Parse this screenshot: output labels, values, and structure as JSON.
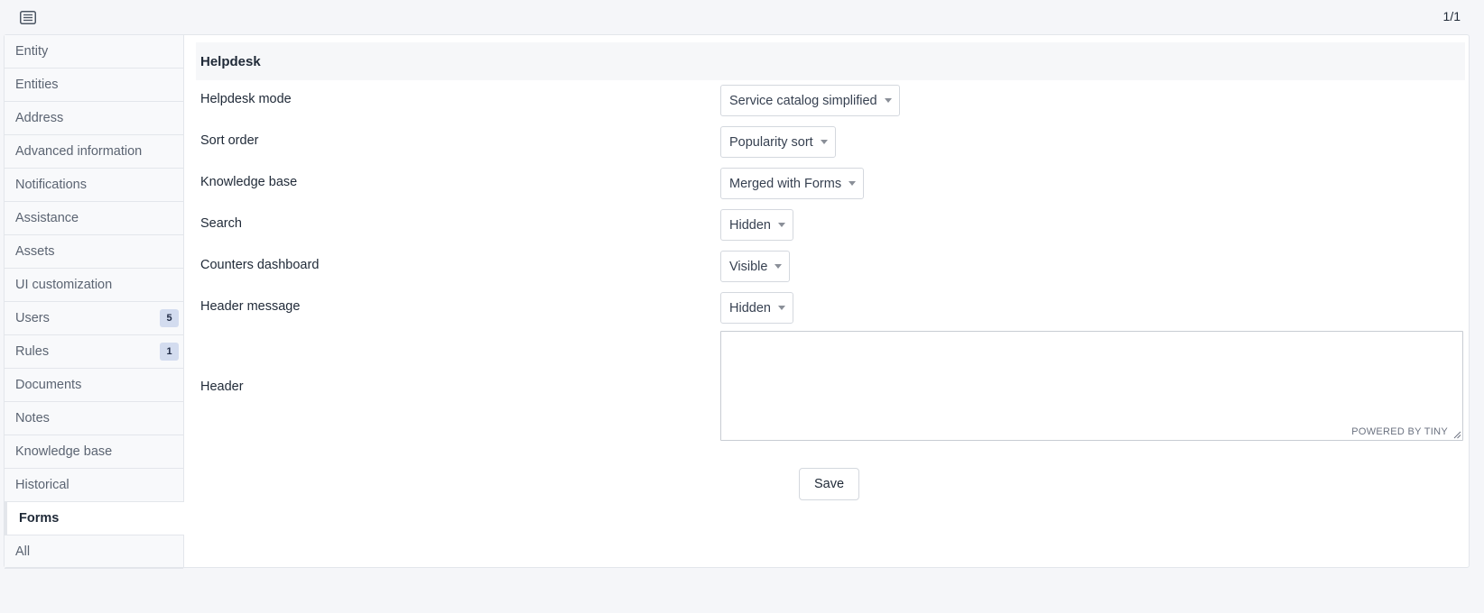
{
  "topbar": {
    "list_toggle_icon": "list-icon",
    "pager": "1/1"
  },
  "tabs": [
    {
      "label": "Entity",
      "badge": null,
      "active": false
    },
    {
      "label": "Entities",
      "badge": null,
      "active": false
    },
    {
      "label": "Address",
      "badge": null,
      "active": false
    },
    {
      "label": "Advanced information",
      "badge": null,
      "active": false
    },
    {
      "label": "Notifications",
      "badge": null,
      "active": false
    },
    {
      "label": "Assistance",
      "badge": null,
      "active": false
    },
    {
      "label": "Assets",
      "badge": null,
      "active": false
    },
    {
      "label": "UI customization",
      "badge": null,
      "active": false
    },
    {
      "label": "Users",
      "badge": "5",
      "active": false
    },
    {
      "label": "Rules",
      "badge": "1",
      "active": false
    },
    {
      "label": "Documents",
      "badge": null,
      "active": false
    },
    {
      "label": "Notes",
      "badge": null,
      "active": false
    },
    {
      "label": "Knowledge base",
      "badge": null,
      "active": false
    },
    {
      "label": "Historical",
      "badge": null,
      "active": false
    },
    {
      "label": "Forms",
      "badge": null,
      "active": true
    },
    {
      "label": "All",
      "badge": null,
      "active": false
    }
  ],
  "form": {
    "section_title": "Helpdesk",
    "fields": {
      "helpdesk_mode": {
        "label": "Helpdesk mode",
        "value": "Service catalog simplified"
      },
      "sort_order": {
        "label": "Sort order",
        "value": "Popularity sort"
      },
      "knowledge_base": {
        "label": "Knowledge base",
        "value": "Merged with Forms"
      },
      "search": {
        "label": "Search",
        "value": "Hidden"
      },
      "counters_dashboard": {
        "label": "Counters dashboard",
        "value": "Visible"
      },
      "header_message": {
        "label": "Header message",
        "value": "Hidden"
      }
    },
    "header": {
      "label": "Header",
      "value": "",
      "powered_by": "POWERED BY TINY"
    },
    "save_label": "Save"
  },
  "colors": {
    "page_bg": "#f5f6f9",
    "badge_bg": "#d3dcef",
    "border": "#e3e6eb"
  }
}
